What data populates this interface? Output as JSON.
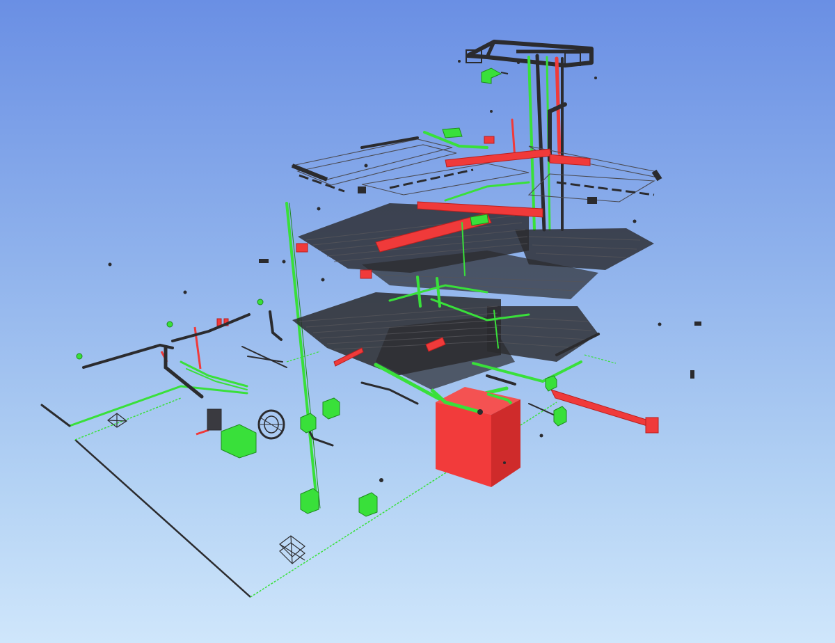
{
  "viewer": {
    "colors": {
      "background_top": "#6a8fe4",
      "background_bottom": "#cfe6fb",
      "pipe_dark": "#2b2b2e",
      "pipe_green": "#39e03a",
      "pipe_red": "#f03a3a",
      "wire": "#4a4a52"
    },
    "elements": [
      "mep-model",
      "floor-level",
      "vertical-riser",
      "red-ductwork",
      "green-pipework",
      "red-tank",
      "green-equipment-unit",
      "ground-outline",
      "wireframe-box",
      "fan-unit"
    ]
  }
}
